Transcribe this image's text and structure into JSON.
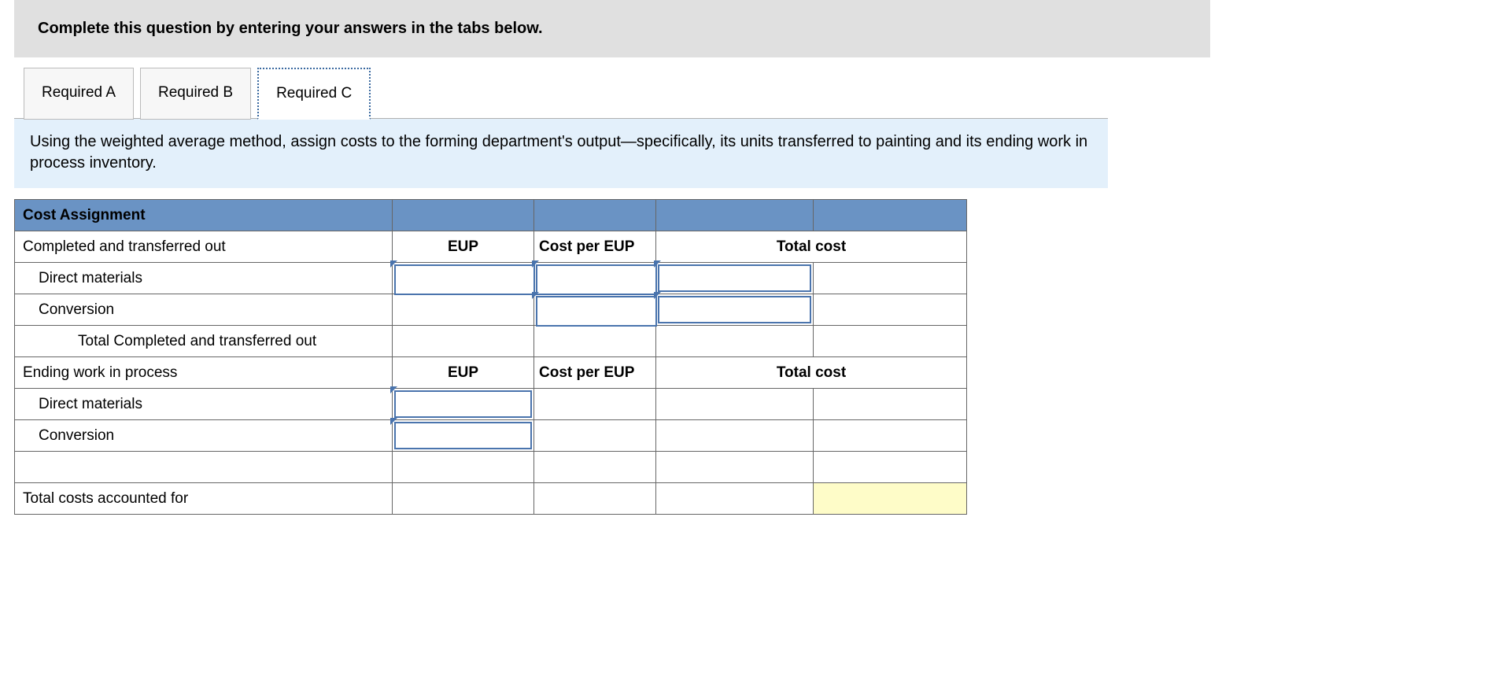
{
  "header": {
    "title": "Complete this question by entering your answers in the tabs below."
  },
  "tabs": [
    {
      "label": "Required A",
      "active": false
    },
    {
      "label": "Required B",
      "active": false
    },
    {
      "label": "Required C",
      "active": true
    }
  ],
  "prompt": "Using the weighted average method, assign costs to the forming department's output—specifically, its units transferred to painting and its ending work in process inventory.",
  "table": {
    "section_title": "Cost Assignment",
    "col_eup": "EUP",
    "col_cpe": "Cost per EUP",
    "col_total": "Total cost",
    "rows": {
      "cto": "Completed and transferred out",
      "dm": "Direct materials",
      "conv": "Conversion",
      "total_cto": "Total Completed and transferred out",
      "ewip": "Ending work in process",
      "total_acc": "Total costs accounted for"
    }
  }
}
